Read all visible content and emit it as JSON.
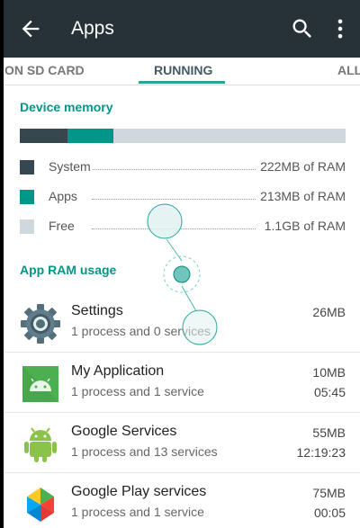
{
  "toolbar": {
    "title": "Apps",
    "back_icon": "arrow-back-icon",
    "search_icon": "search-icon",
    "overflow_icon": "more-vert-icon",
    "background": "#263238"
  },
  "tabs": [
    {
      "label": "ON SD CARD",
      "active": false
    },
    {
      "label": "RUNNING",
      "active": true
    },
    {
      "label": "ALL",
      "active": false
    }
  ],
  "device_memory": {
    "title": "Device memory",
    "bar": {
      "system_fraction": 0.146,
      "apps_fraction": 0.14,
      "colors": {
        "system": "#37474f",
        "apps": "#009688",
        "free": "#cfd8dc"
      }
    },
    "legend": [
      {
        "label": "System",
        "value": "222MB of RAM",
        "color": "#37474f"
      },
      {
        "label": "Apps",
        "value": "213MB of RAM",
        "color": "#009688"
      },
      {
        "label": "Free",
        "value": "1.1GB of RAM",
        "color": "#cfd8dc"
      }
    ]
  },
  "app_ram": {
    "title": "App RAM usage",
    "apps": [
      {
        "name": "Settings",
        "detail": "1 process and 0 services",
        "size": "26MB",
        "time": "",
        "icon": "settings-gear-icon"
      },
      {
        "name": "My Application",
        "detail": "1 process and 1 service",
        "size": "10MB",
        "time": "05:45",
        "icon": "android-app-icon"
      },
      {
        "name": "Google Services",
        "detail": "1 process and 13 services",
        "size": "55MB",
        "time": "12:19:23",
        "icon": "android-robot-icon"
      },
      {
        "name": "Google Play services",
        "detail": "1 process and 1 service",
        "size": "75MB",
        "time": "00:05",
        "icon": "google-play-services-icon"
      }
    ]
  },
  "accent_color": "#009688"
}
